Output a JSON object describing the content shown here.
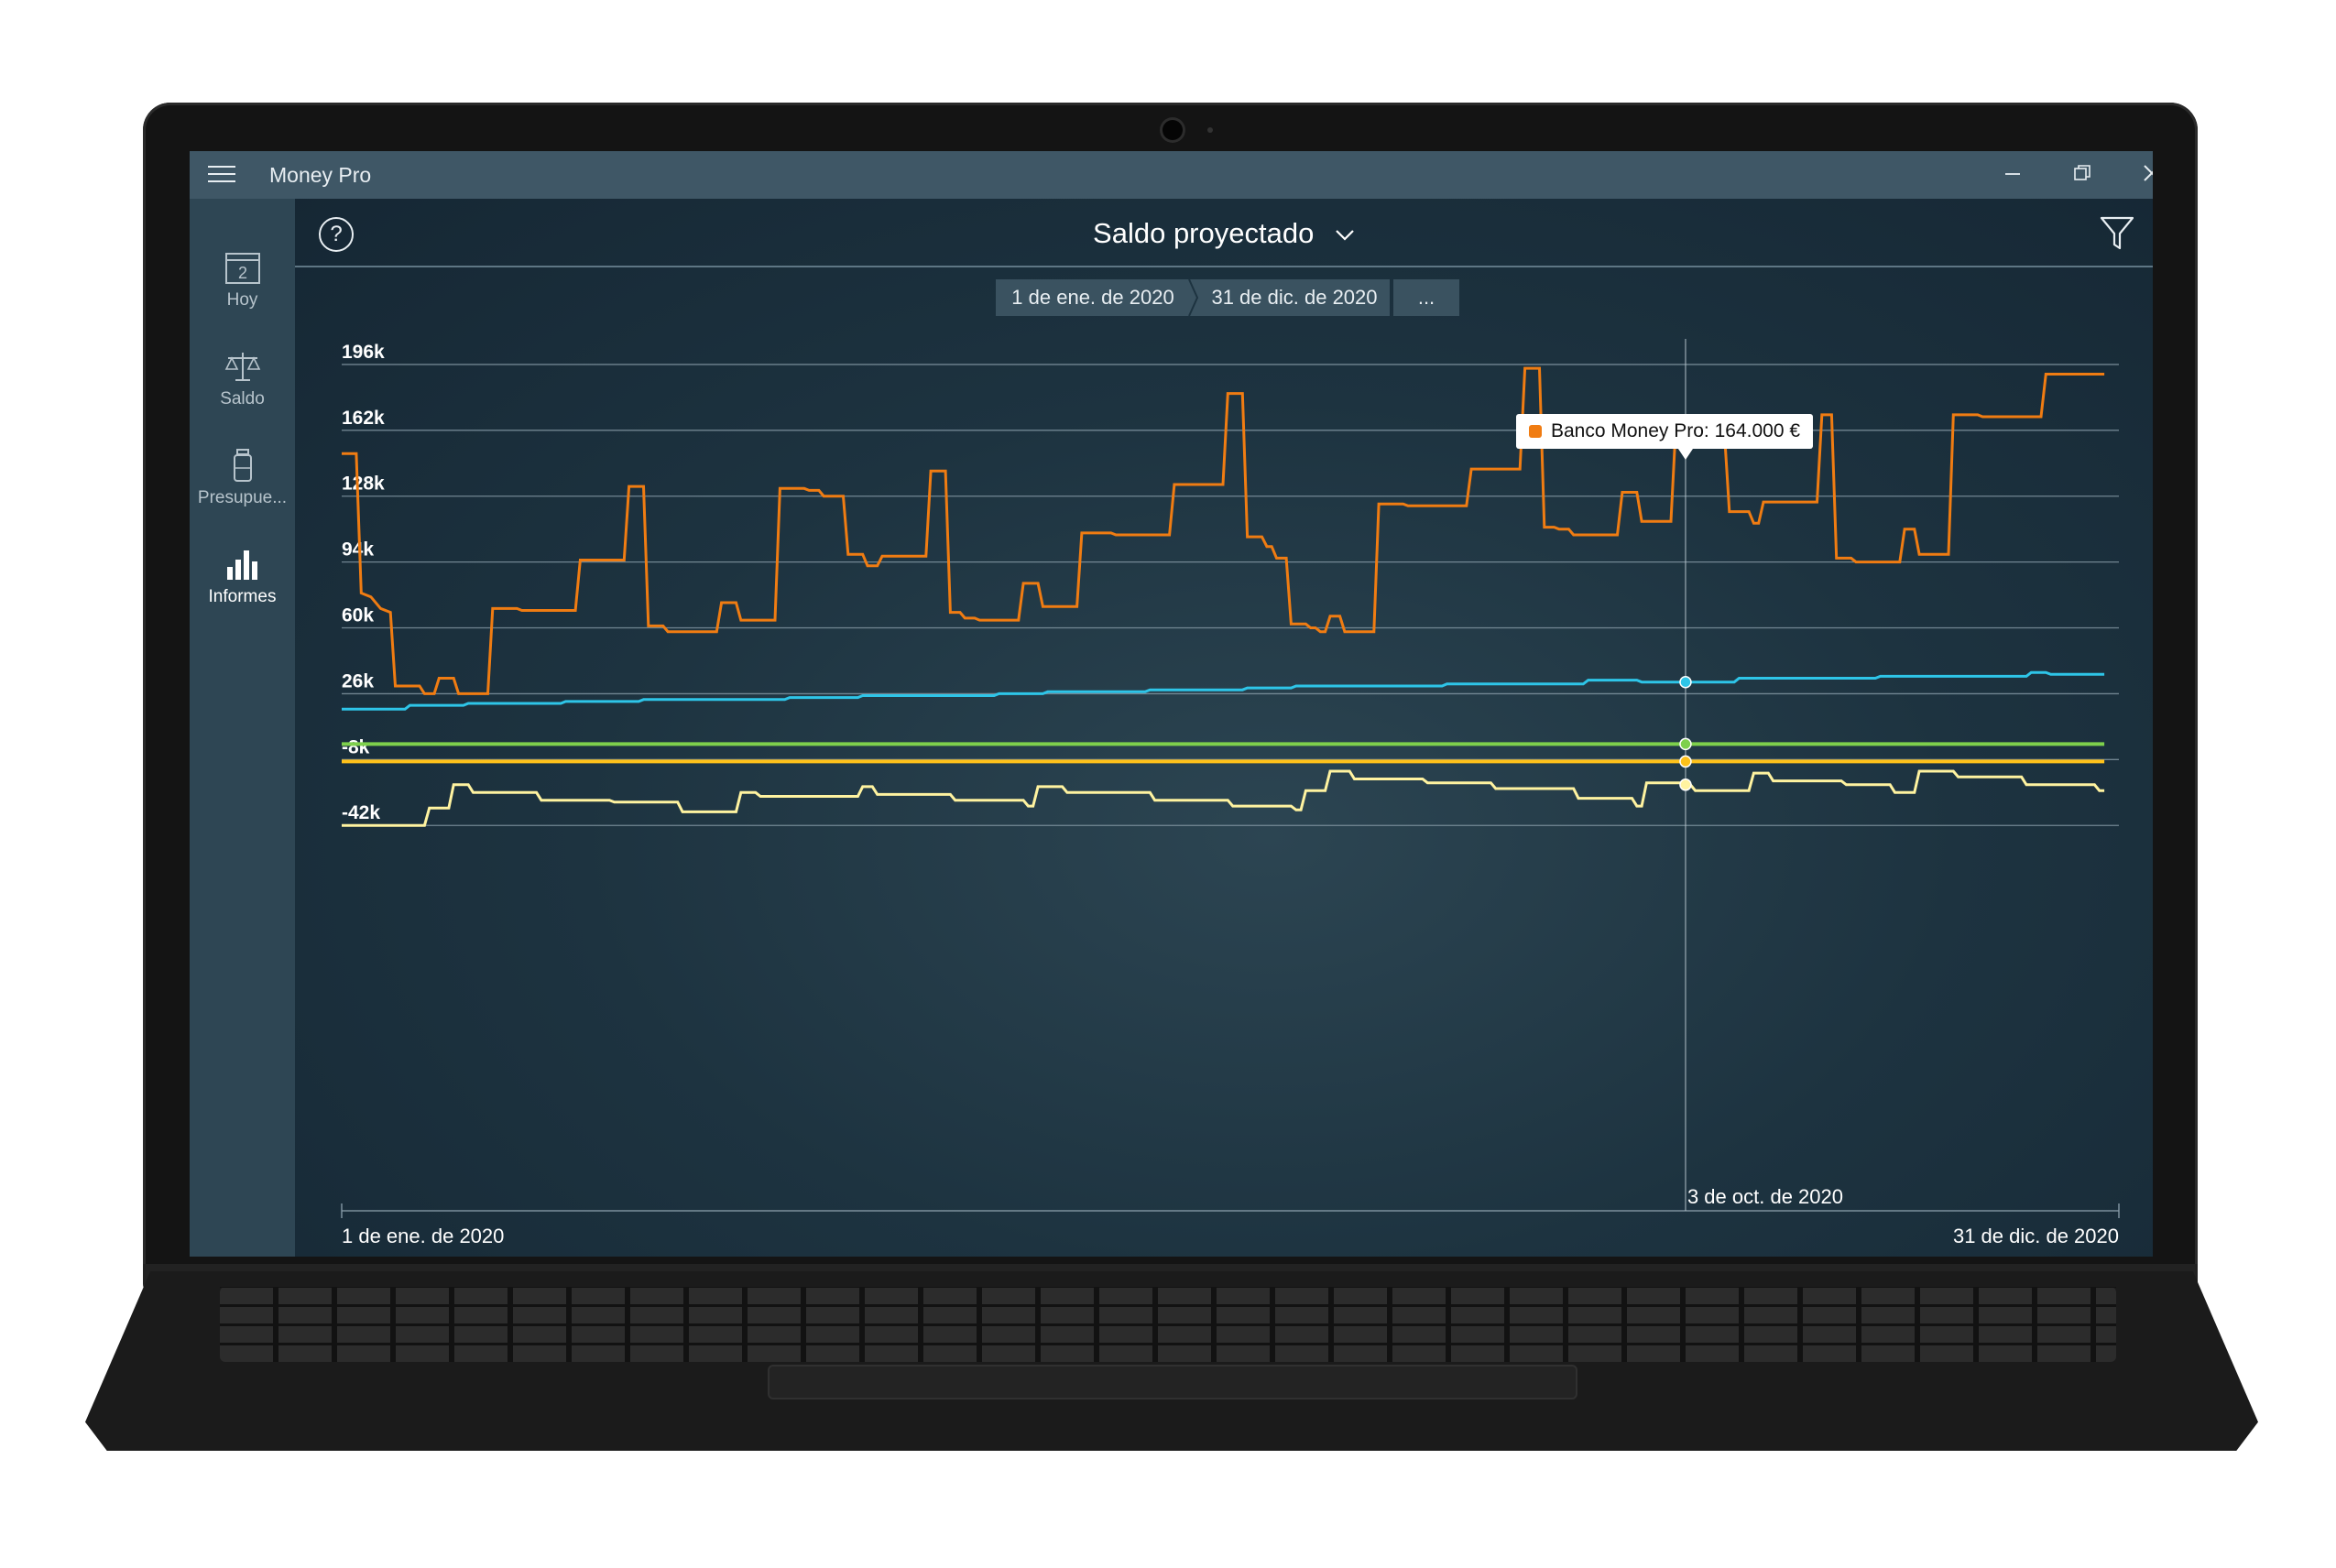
{
  "window": {
    "title": "Money Pro",
    "minimize_icon": "minimize-icon",
    "maximize_icon": "restore-icon",
    "close_icon": "close-icon"
  },
  "sidebar": {
    "items": [
      {
        "label": "Hoy",
        "icon": "calendar-icon",
        "icon_text": "2"
      },
      {
        "label": "Saldo",
        "icon": "balance-scale-icon"
      },
      {
        "label": "Presupue...",
        "icon": "budget-jar-icon"
      },
      {
        "label": "Informes",
        "icon": "bar-chart-icon",
        "active": true
      }
    ]
  },
  "header": {
    "title": "Saldo proyectado",
    "help_icon": "help-icon",
    "help_text": "?",
    "filter_icon": "filter-icon"
  },
  "date_range": {
    "start": "1 de ene. de 2020",
    "end": "31 de dic. de 2020",
    "more": "..."
  },
  "tooltip": {
    "text": "Banco Money Pro: 164.000 €",
    "color": "#f07c12"
  },
  "chart_data": {
    "type": "line",
    "step": true,
    "yticks": [
      "196k",
      "162k",
      "128k",
      "94k",
      "60k",
      "26k",
      "-8k",
      "-42k"
    ],
    "ytick_values": [
      196,
      162,
      128,
      94,
      60,
      26,
      -8,
      -42
    ],
    "ylim": [
      -52,
      196
    ],
    "x_start_label": "1 de ene. de 2020",
    "x_end_label": "31 de dic. de 2020",
    "cursor_label": "3 de oct. de 2020",
    "cursor_day": 276,
    "xlim": [
      0,
      365
    ],
    "series": [
      {
        "color": "#f07c12",
        "points": [
          [
            0,
            150
          ],
          [
            3,
            150
          ],
          [
            4,
            78
          ],
          [
            6,
            76
          ],
          [
            8,
            70
          ],
          [
            10,
            68
          ],
          [
            11,
            30
          ],
          [
            16,
            30
          ],
          [
            17,
            26
          ],
          [
            19,
            26
          ],
          [
            20,
            34
          ],
          [
            23,
            34
          ],
          [
            24,
            26
          ],
          [
            30,
            26
          ],
          [
            31,
            70
          ],
          [
            36,
            70
          ],
          [
            37,
            69
          ],
          [
            48,
            69
          ],
          [
            49,
            95
          ],
          [
            58,
            95
          ],
          [
            59,
            133
          ],
          [
            62,
            133
          ],
          [
            63,
            61
          ],
          [
            66,
            61
          ],
          [
            67,
            58
          ],
          [
            77,
            58
          ],
          [
            78,
            73
          ],
          [
            81,
            73
          ],
          [
            82,
            64
          ],
          [
            89,
            64
          ],
          [
            90,
            132
          ],
          [
            95,
            132
          ],
          [
            96,
            131
          ],
          [
            98,
            131
          ],
          [
            99,
            128
          ],
          [
            103,
            128
          ],
          [
            104,
            98
          ],
          [
            107,
            98
          ],
          [
            108,
            92
          ],
          [
            110,
            92
          ],
          [
            111,
            97
          ],
          [
            120,
            97
          ],
          [
            121,
            141
          ],
          [
            124,
            141
          ],
          [
            125,
            68
          ],
          [
            127,
            68
          ],
          [
            128,
            65
          ],
          [
            130,
            65
          ],
          [
            131,
            64
          ],
          [
            139,
            64
          ],
          [
            140,
            83
          ],
          [
            143,
            83
          ],
          [
            144,
            71
          ],
          [
            151,
            71
          ],
          [
            152,
            109
          ],
          [
            158,
            109
          ],
          [
            159,
            108
          ],
          [
            170,
            108
          ],
          [
            171,
            134
          ],
          [
            181,
            134
          ],
          [
            182,
            181
          ],
          [
            185,
            181
          ],
          [
            186,
            107
          ],
          [
            189,
            107
          ],
          [
            190,
            102
          ],
          [
            191,
            102
          ],
          [
            192,
            96
          ],
          [
            194,
            96
          ],
          [
            195,
            62
          ],
          [
            198,
            62
          ],
          [
            199,
            60
          ],
          [
            200,
            60
          ],
          [
            201,
            58
          ],
          [
            202,
            58
          ],
          [
            203,
            66
          ],
          [
            205,
            66
          ],
          [
            206,
            58
          ],
          [
            212,
            58
          ],
          [
            213,
            124
          ],
          [
            218,
            124
          ],
          [
            219,
            123
          ],
          [
            231,
            123
          ],
          [
            232,
            142
          ],
          [
            242,
            142
          ],
          [
            243,
            194
          ],
          [
            246,
            194
          ],
          [
            247,
            112
          ],
          [
            249,
            112
          ],
          [
            250,
            111
          ],
          [
            252,
            111
          ],
          [
            253,
            108
          ],
          [
            262,
            108
          ],
          [
            263,
            130
          ],
          [
            266,
            130
          ],
          [
            267,
            115
          ],
          [
            273,
            115
          ],
          [
            274,
            164
          ],
          [
            277,
            164
          ],
          [
            278,
            163
          ],
          [
            281,
            163
          ],
          [
            282,
            160
          ],
          [
            284,
            160
          ],
          [
            285,
            120
          ],
          [
            289,
            120
          ],
          [
            290,
            114
          ],
          [
            291,
            114
          ],
          [
            292,
            125
          ],
          [
            303,
            125
          ],
          [
            304,
            170
          ],
          [
            306,
            170
          ],
          [
            307,
            96
          ],
          [
            310,
            96
          ],
          [
            311,
            94
          ],
          [
            320,
            94
          ],
          [
            321,
            111
          ],
          [
            323,
            111
          ],
          [
            324,
            98
          ],
          [
            330,
            98
          ],
          [
            331,
            170
          ],
          [
            336,
            170
          ],
          [
            337,
            169
          ],
          [
            349,
            169
          ],
          [
            350,
            191
          ],
          [
            362,
            191
          ]
        ]
      },
      {
        "color": "#2ec5e8",
        "points": [
          [
            0,
            18
          ],
          [
            13,
            18
          ],
          [
            14,
            20
          ],
          [
            25,
            20
          ],
          [
            26,
            21
          ],
          [
            45,
            21
          ],
          [
            46,
            22
          ],
          [
            61,
            22
          ],
          [
            62,
            23
          ],
          [
            91,
            23
          ],
          [
            92,
            24
          ],
          [
            106,
            24
          ],
          [
            107,
            25
          ],
          [
            134,
            25
          ],
          [
            135,
            26
          ],
          [
            144,
            26
          ],
          [
            145,
            27
          ],
          [
            165,
            27
          ],
          [
            166,
            28
          ],
          [
            185,
            28
          ],
          [
            186,
            29
          ],
          [
            195,
            29
          ],
          [
            196,
            30
          ],
          [
            226,
            30
          ],
          [
            227,
            31
          ],
          [
            255,
            31
          ],
          [
            256,
            33
          ],
          [
            266,
            33
          ],
          [
            267,
            32
          ],
          [
            286,
            32
          ],
          [
            287,
            34
          ],
          [
            315,
            34
          ],
          [
            316,
            35
          ],
          [
            346,
            35
          ],
          [
            347,
            37
          ],
          [
            350,
            37
          ],
          [
            351,
            36
          ],
          [
            362,
            36
          ]
        ]
      },
      {
        "color": "#7ed04c",
        "points": [
          [
            0,
            0
          ],
          [
            362,
            0
          ]
        ]
      },
      {
        "color": "#ffc21a",
        "points": [
          [
            0,
            -9
          ],
          [
            362,
            -9
          ]
        ]
      },
      {
        "color": "#fff3a0",
        "points": [
          [
            0,
            -42
          ],
          [
            17,
            -42
          ],
          [
            18,
            -33
          ],
          [
            22,
            -33
          ],
          [
            23,
            -21
          ],
          [
            26,
            -21
          ],
          [
            27,
            -25
          ],
          [
            40,
            -25
          ],
          [
            41,
            -29
          ],
          [
            55,
            -29
          ],
          [
            56,
            -30
          ],
          [
            69,
            -30
          ],
          [
            70,
            -35
          ],
          [
            81,
            -35
          ],
          [
            82,
            -25
          ],
          [
            85,
            -25
          ],
          [
            86,
            -27
          ],
          [
            106,
            -27
          ],
          [
            107,
            -22
          ],
          [
            109,
            -22
          ],
          [
            110,
            -26
          ],
          [
            125,
            -26
          ],
          [
            126,
            -29
          ],
          [
            140,
            -29
          ],
          [
            141,
            -32
          ],
          [
            142,
            -32
          ],
          [
            143,
            -22
          ],
          [
            148,
            -22
          ],
          [
            149,
            -25
          ],
          [
            166,
            -25
          ],
          [
            167,
            -29
          ],
          [
            182,
            -29
          ],
          [
            183,
            -32
          ],
          [
            195,
            -32
          ],
          [
            196,
            -34
          ],
          [
            197,
            -34
          ],
          [
            198,
            -24
          ],
          [
            202,
            -24
          ],
          [
            203,
            -14
          ],
          [
            207,
            -14
          ],
          [
            208,
            -18
          ],
          [
            222,
            -18
          ],
          [
            223,
            -20
          ],
          [
            236,
            -20
          ],
          [
            237,
            -23
          ],
          [
            253,
            -23
          ],
          [
            254,
            -28
          ],
          [
            265,
            -28
          ],
          [
            266,
            -32
          ],
          [
            267,
            -32
          ],
          [
            268,
            -20
          ],
          [
            275,
            -20
          ],
          [
            276,
            -21
          ],
          [
            277,
            -21
          ],
          [
            278,
            -24
          ],
          [
            289,
            -24
          ],
          [
            290,
            -15
          ],
          [
            293,
            -15
          ],
          [
            294,
            -19
          ],
          [
            308,
            -19
          ],
          [
            309,
            -21
          ],
          [
            318,
            -21
          ],
          [
            319,
            -25
          ],
          [
            323,
            -25
          ],
          [
            324,
            -14
          ],
          [
            331,
            -14
          ],
          [
            332,
            -17
          ],
          [
            345,
            -17
          ],
          [
            346,
            -21
          ],
          [
            360,
            -21
          ],
          [
            361,
            -24
          ],
          [
            362,
            -24
          ]
        ]
      }
    ]
  }
}
